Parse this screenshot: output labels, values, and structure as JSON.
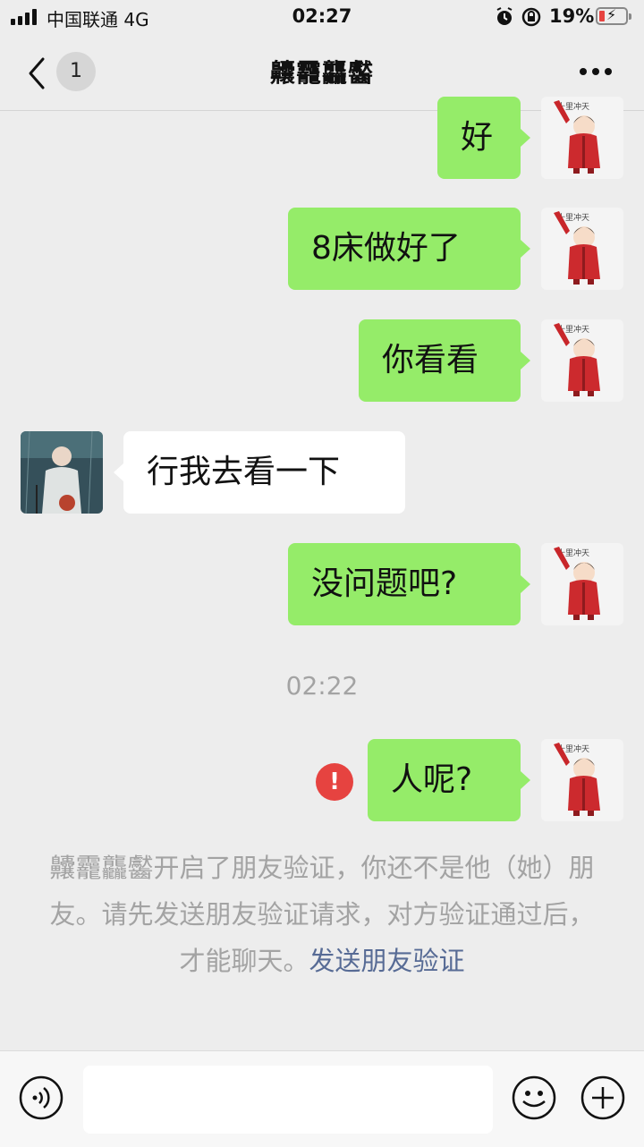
{
  "status_bar": {
    "carrier": "中国联通 4G",
    "time": "02:27",
    "battery_percent": "19%",
    "battery_level": 0.19,
    "colors": {
      "battery_low": "#e64340"
    }
  },
  "nav": {
    "back_icon": "chevron-left-icon",
    "unread_count": "1",
    "title": "齉龗龘齾",
    "more_icon": "more-dots-icon"
  },
  "messages": [
    {
      "side": "out",
      "text": "好"
    },
    {
      "side": "out",
      "text": "8床做好了"
    },
    {
      "side": "out",
      "text": "你看看"
    },
    {
      "side": "in",
      "text": "行我去看一下"
    },
    {
      "side": "out",
      "text": "没问题吧?"
    },
    {
      "side": "out",
      "text": "人呢?",
      "failed": true
    }
  ],
  "timestamp": "02:22",
  "system_note": {
    "text": "齉龗龘齾开启了朋友验证，你还不是他（她）朋友。请先发送朋友验证请求，对方验证通过后，才能聊天。",
    "link": "发送朋友验证"
  },
  "input_bar": {
    "voice_icon": "voice-icon",
    "emoji_icon": "emoji-icon",
    "plus_icon": "plus-circle-icon"
  },
  "colors": {
    "background": "#ededed",
    "outgoing_bubble": "#95ec69",
    "incoming_bubble": "#ffffff",
    "link": "#576b95",
    "error": "#e64340"
  }
}
